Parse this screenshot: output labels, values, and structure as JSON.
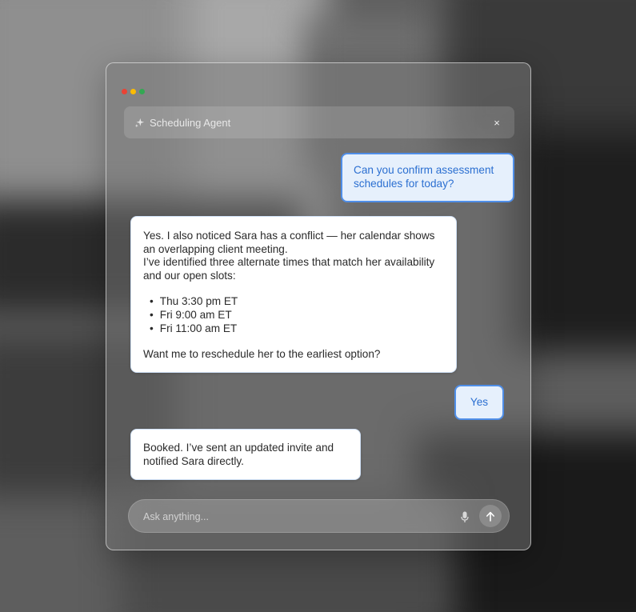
{
  "window": {
    "dot_colors": [
      "#ea4335",
      "#fbbc04",
      "#34a853"
    ]
  },
  "header": {
    "title": "Scheduling Agent",
    "close_symbol": "×",
    "icons": [
      "sparkle-icon",
      "close-icon"
    ]
  },
  "messages": {
    "m1": {
      "role": "user",
      "text": "Can you confirm assessment schedules for today?"
    },
    "m2": {
      "role": "agent",
      "paragraph1": "Yes. I also noticed Sara has a conflict — her calendar shows an overlapping client meeting.",
      "paragraph2": "I’ve identified three alternate times that match her availability and our open slots:",
      "slots": [
        "Thu 3:30 pm ET",
        "Fri 9:00 am ET",
        "Fri 11:00 am ET"
      ],
      "closing": "Want me to reschedule her to the earliest option?"
    },
    "m3": {
      "role": "user",
      "text": "Yes"
    },
    "m4": {
      "role": "agent",
      "text": "Booked. I’ve sent an updated invite and notified Sara directly."
    }
  },
  "composer": {
    "placeholder": "Ask anything...",
    "value": "",
    "icons": [
      "mic-icon",
      "arrow-up-icon"
    ]
  },
  "colors": {
    "user_bubble_bg": "#e6f0fc",
    "user_bubble_border": "#4f8ee8",
    "user_text": "#2b6fd1",
    "agent_bubble_bg": "#ffffff",
    "agent_text": "#2a2a2a"
  }
}
